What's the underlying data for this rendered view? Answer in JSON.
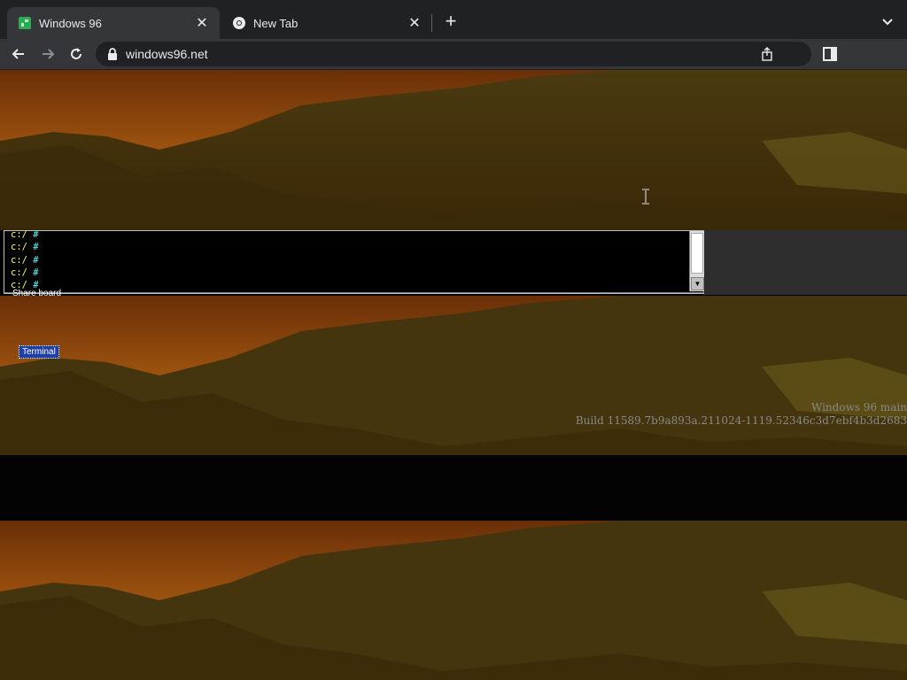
{
  "browser": {
    "tabs": [
      {
        "title": "Windows 96",
        "favicon": "windows96-icon",
        "active": true
      },
      {
        "title": "New Tab",
        "favicon": "chrome-icon",
        "active": false
      }
    ],
    "url": "windows96.net"
  },
  "desktop": {
    "terminal": {
      "lines": [
        "c:/ #",
        "c:/ #",
        "c:/ #",
        "c:/ #",
        "c:/ #"
      ]
    },
    "partial_label": "Share board",
    "icon_label": "Terminal",
    "build_info": {
      "line1": "Windows 96 main",
      "line2": "Build 11589.7b9a893a.211024-1119.52346c3d7ebf4b3d2683"
    }
  },
  "colors": {
    "tab_strip": "#202124",
    "toolbar": "#35363a",
    "terminal_prompt": "#ffff55",
    "terminal_hash": "#55ffff",
    "selection": "#1f3ea6"
  }
}
